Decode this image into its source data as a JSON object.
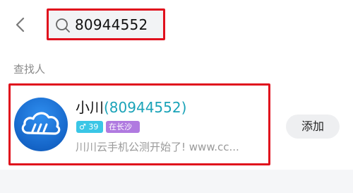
{
  "search": {
    "query": "80944552"
  },
  "section": {
    "title": "查找人"
  },
  "result": {
    "name": "小川",
    "id_display": "(80944552)",
    "gender_symbol": "♂",
    "age": "39",
    "city": "在长沙",
    "signature": "川川云手机公测开始了! www.cc...",
    "add_label": "添加"
  },
  "colors": {
    "highlight": "#e0101d",
    "id_text": "#1aa3b8",
    "gender_badge": "#3ac6e6",
    "city_badge": "#b07ae0"
  },
  "icons": {
    "back": "chevron-left-icon",
    "search": "search-icon",
    "avatar": "cloud-logo-icon"
  }
}
